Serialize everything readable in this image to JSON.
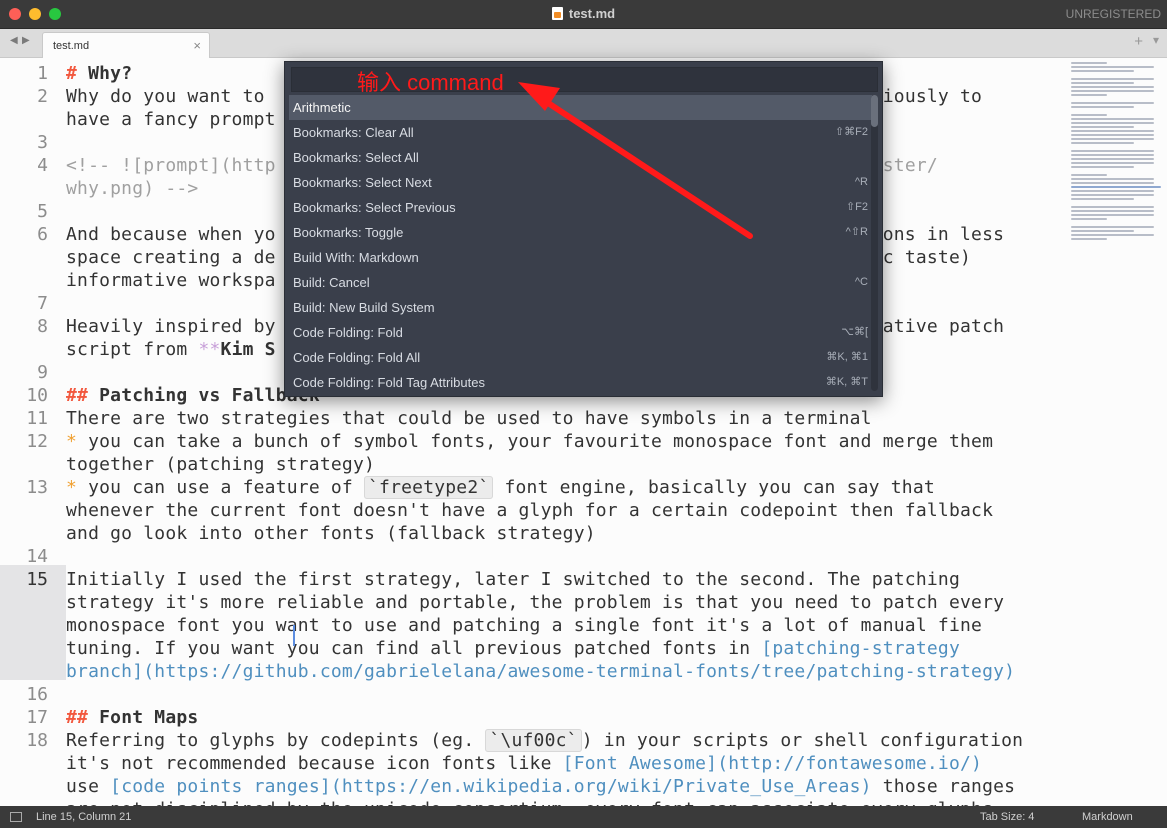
{
  "window": {
    "title": "test.md",
    "unregistered": "UNREGISTERED"
  },
  "tabbar": {
    "nav_left": "◀",
    "nav_right": "▶",
    "tab_label": "test.md",
    "tab_close": "×",
    "new_tab": "+",
    "tab_menu": "▾"
  },
  "gutter": {
    "line_numbers": [
      "1",
      "2",
      "3",
      "4",
      "5",
      "6",
      "7",
      "8",
      "9",
      "10",
      "11",
      "12",
      "13",
      "14",
      "15",
      "16",
      "17",
      "18"
    ],
    "current_line": "15"
  },
  "editor": {
    "lines": [
      {
        "id": "l1a",
        "parts": [
          [
            "hd",
            "# "
          ],
          [
            "hdt",
            "Why?"
          ]
        ]
      },
      {
        "id": "l2a",
        "parts": [
          [
            "",
            "Why do you want to "
          ],
          [
            "",
            "                                                     "
          ],
          [
            "",
            "bviously to"
          ]
        ]
      },
      {
        "id": "l2b",
        "parts": [
          [
            "",
            "have a fancy prompt"
          ]
        ]
      },
      {
        "id": "l4a",
        "parts": [
          [
            "cm",
            "<!-- ![prompt](http"
          ],
          [
            "",
            ""
          ],
          [
            "cm",
            "                                                  "
          ],
          [
            "cm",
            "aw/master/"
          ]
        ]
      },
      {
        "id": "l4b",
        "parts": [
          [
            "cm",
            "why.png) -->"
          ]
        ]
      },
      {
        "id": "l6a",
        "parts": [
          [
            "",
            "And because when yo"
          ],
          [
            "",
            "                                                    "
          ],
          [
            "",
            "ations in less"
          ]
        ]
      },
      {
        "id": "l6b",
        "parts": [
          [
            "",
            "space creating a de"
          ],
          [
            "",
            "                                                   "
          ],
          [
            "",
            "hetic taste)"
          ]
        ]
      },
      {
        "id": "l6c",
        "parts": [
          [
            "",
            "informative workspa"
          ]
        ]
      },
      {
        "id": "l8a",
        "parts": [
          [
            "",
            "Heavily inspired by"
          ],
          [
            "",
            "                                                    "
          ],
          [
            "",
            "relative patch"
          ]
        ]
      },
      {
        "id": "l8b",
        "parts": [
          [
            "",
            "script from "
          ],
          [
            "bl",
            "**"
          ],
          [
            "bold",
            "Kim S"
          ]
        ]
      },
      {
        "id": "l10a",
        "parts": [
          [
            "hd",
            "## "
          ],
          [
            "hdt",
            "Patching vs Fallback"
          ]
        ]
      },
      {
        "id": "l11a",
        "parts": [
          [
            "",
            "There are two strategies that could be used to have symbols in a terminal"
          ]
        ]
      },
      {
        "id": "l12a",
        "parts": [
          [
            "bullet",
            "*"
          ],
          [
            "",
            " you can take a bunch of symbol fonts, your favourite monospace font and merge them"
          ]
        ]
      },
      {
        "id": "l12b",
        "parts": [
          [
            "",
            "together (patching strategy)"
          ]
        ]
      },
      {
        "id": "l13a",
        "parts": [
          [
            "bullet",
            "*"
          ],
          [
            "",
            " you can use a feature of "
          ],
          [
            "cd",
            "`freetype2`"
          ],
          [
            "",
            " font engine, basically you can say that"
          ]
        ]
      },
      {
        "id": "l13b",
        "parts": [
          [
            "",
            "whenever the current font doesn't have a glyph for a certain codepoint then fallback"
          ]
        ]
      },
      {
        "id": "l13c",
        "parts": [
          [
            "",
            "and go look into other fonts (fallback strategy)"
          ]
        ]
      },
      {
        "id": "l15a",
        "parts": [
          [
            "",
            "Initially I used the first strategy, later I switched to the second. The patching"
          ]
        ]
      },
      {
        "id": "l15b",
        "parts": [
          [
            "",
            "strategy it's more reliable and portable, the problem is that you need to patch every"
          ]
        ]
      },
      {
        "id": "l15c",
        "parts": [
          [
            "",
            "monospace font you want to use and patching a single font it's a lot of manual fine"
          ]
        ]
      },
      {
        "id": "l15d",
        "parts": [
          [
            "",
            "tuning. If you want you can find all previous patched fonts in "
          ],
          [
            "lk",
            "[patching-strategy"
          ]
        ]
      },
      {
        "id": "l15e",
        "parts": [
          [
            "lk",
            "branch](https://github.com/gabrielelana/awesome-terminal-fonts/tree/patching-strategy)"
          ]
        ]
      },
      {
        "id": "l17a",
        "parts": [
          [
            "hd",
            "## "
          ],
          [
            "hdt",
            "Font Maps"
          ]
        ]
      },
      {
        "id": "l18a",
        "parts": [
          [
            "",
            "Referring to glyphs by codepints (eg. "
          ],
          [
            "cd",
            "`\\uf00c`"
          ],
          [
            "",
            ") in your scripts or shell configuration"
          ]
        ]
      },
      {
        "id": "l18b",
        "parts": [
          [
            "",
            "it's not recommended because icon fonts like "
          ],
          [
            "lk",
            "[Font Awesome](http://fontawesome.io/)"
          ]
        ]
      },
      {
        "id": "l18c",
        "parts": [
          [
            "",
            "use "
          ],
          [
            "lk",
            "[code points ranges](https://en.wikipedia.org/wiki/Private_Use_Areas)"
          ],
          [
            "",
            " those ranges"
          ]
        ]
      },
      {
        "id": "l18d",
        "parts": [
          [
            "",
            "are not disciplined by the unicode consortium, every font can associate every glyphs"
          ]
        ]
      }
    ]
  },
  "palette": {
    "input_value": "",
    "items": [
      {
        "label": "Arithmetic",
        "shortcut": "",
        "selected": true
      },
      {
        "label": "Bookmarks: Clear All",
        "shortcut": "⇧⌘F2",
        "selected": false
      },
      {
        "label": "Bookmarks: Select All",
        "shortcut": "",
        "selected": false
      },
      {
        "label": "Bookmarks: Select Next",
        "shortcut": "^R",
        "selected": false
      },
      {
        "label": "Bookmarks: Select Previous",
        "shortcut": "⇧F2",
        "selected": false
      },
      {
        "label": "Bookmarks: Toggle",
        "shortcut": "^⇧R",
        "selected": false
      },
      {
        "label": "Build With: Markdown",
        "shortcut": "",
        "selected": false
      },
      {
        "label": "Build: Cancel",
        "shortcut": "^C",
        "selected": false
      },
      {
        "label": "Build: New Build System",
        "shortcut": "",
        "selected": false
      },
      {
        "label": "Code Folding: Fold",
        "shortcut": "⌥⌘[",
        "selected": false
      },
      {
        "label": "Code Folding: Fold All",
        "shortcut": "⌘K, ⌘1",
        "selected": false
      },
      {
        "label": "Code Folding: Fold Tag Attributes",
        "shortcut": "⌘K, ⌘T",
        "selected": false
      }
    ]
  },
  "annotation": {
    "text": "输入 command",
    "color": "#ff1a1a"
  },
  "statusbar": {
    "position": "Line 15, Column 21",
    "tab_size": "Tab Size: 4",
    "syntax": "Markdown"
  },
  "colors": {
    "heading": "#f2583e",
    "link": "#4f8fbf",
    "comment": "#a0a0a0",
    "palette_bg": "#3a3f4b",
    "selection": "#535a68"
  }
}
